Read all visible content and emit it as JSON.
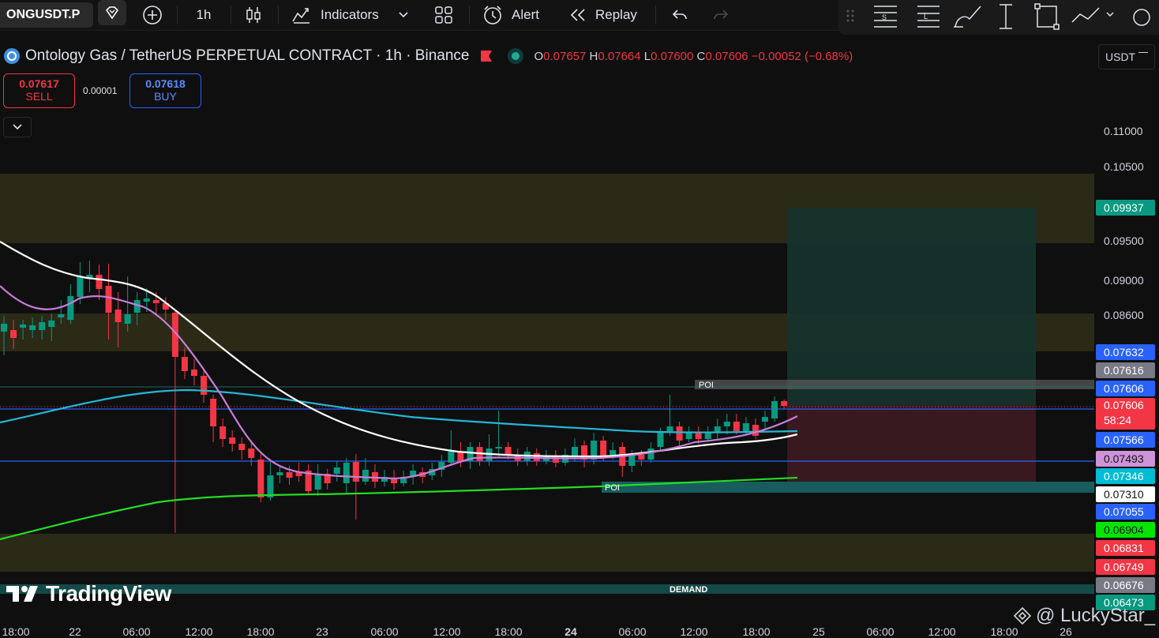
{
  "toolbar": {
    "symbol": "ONGUSDT.P",
    "timeframe": "1h",
    "indicators_label": "Indicators",
    "alert_label": "Alert",
    "replay_label": "Replay"
  },
  "header": {
    "title": "Ontology Gas / TetherUS PERPETUAL CONTRACT · 1h · Binance",
    "open_key": "O",
    "open": "0.07657",
    "high_key": "H",
    "high": "0.07664",
    "low_key": "L",
    "low": "0.07600",
    "close_key": "C",
    "close": "0.07606",
    "change": "−0.00052 (−0.68%)"
  },
  "trade": {
    "sell_price": "0.07617",
    "sell_label": "SELL",
    "spread": "0.00001",
    "buy_price": "0.07618",
    "buy_label": "BUY"
  },
  "currency_select": "USDT",
  "price_axis": {
    "ticks": [
      "0.11000",
      "0.10500",
      "0.09500",
      "0.09000",
      "0.08600"
    ],
    "badges": [
      {
        "text": "0.09937",
        "color": "#089981"
      },
      {
        "text": "0.07632",
        "color": "#2962ff"
      },
      {
        "text": "0.07616",
        "color": "#787b86"
      },
      {
        "text": "0.07606",
        "color": "#2962ff"
      },
      {
        "text": "0.07606",
        "color": "#f23645",
        "sub": "58:24"
      },
      {
        "text": "0.07566",
        "color": "#2962ff"
      },
      {
        "text": "0.07493",
        "color": "#ce93d8"
      },
      {
        "text": "0.07346",
        "color": "#00bcd4"
      },
      {
        "text": "0.07310",
        "color": "#ffffff"
      },
      {
        "text": "0.07055",
        "color": "#2962ff"
      },
      {
        "text": "0.06904",
        "color": "#00e600"
      },
      {
        "text": "0.06831",
        "color": "#f23645"
      },
      {
        "text": "0.06749",
        "color": "#f23645"
      },
      {
        "text": "0.06676",
        "color": "#787b86"
      },
      {
        "text": "0.06473",
        "color": "#089981"
      }
    ]
  },
  "time_axis": [
    "18:00",
    "22",
    "06:00",
    "12:00",
    "18:00",
    "23",
    "06:00",
    "12:00",
    "18:00",
    "24",
    "06:00",
    "12:00",
    "18:00",
    "25",
    "06:00",
    "12:00",
    "18:00",
    "26"
  ],
  "annotations": {
    "poi_upper": "POI",
    "poi_lower": "POI",
    "demand": "DEMAND"
  },
  "branding": {
    "logo": "TradingView",
    "credit": "@ LuckyStar_"
  },
  "colors": {
    "up": "#089981",
    "down": "#f23645",
    "zone": "#2b2a17",
    "ema_fast": "#c77dd7",
    "ema_mid": "#ffffff",
    "ema_slow": "#26b6d4",
    "ema_long": "#22dd22"
  }
}
